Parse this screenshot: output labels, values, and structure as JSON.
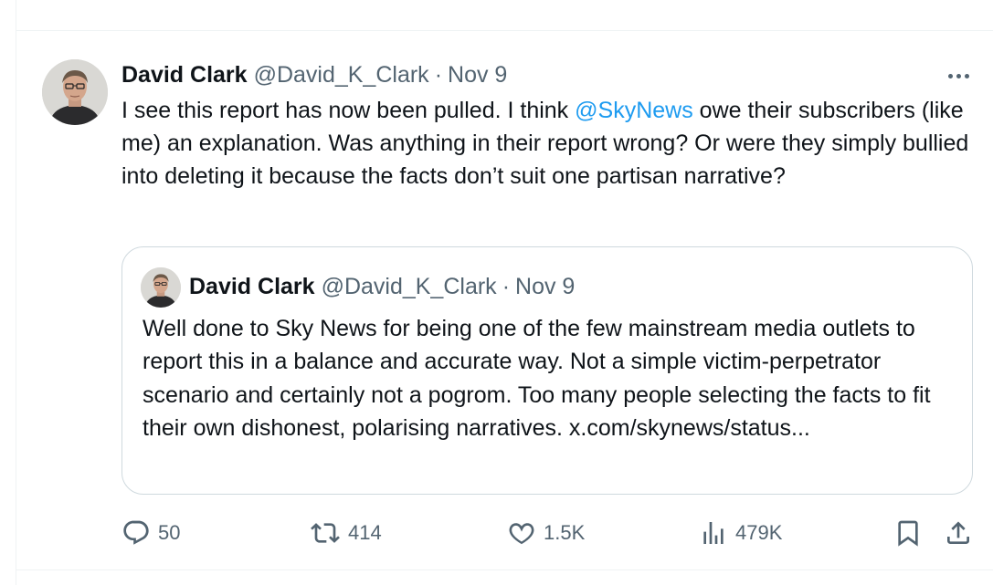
{
  "post": {
    "author_name": "David Clark",
    "author_handle": "@David_K_Clark",
    "separator": "·",
    "date": "Nov 9",
    "text_before_mention": "I see this report has now been pulled. I think ",
    "mention": "@SkyNews",
    "text_after_mention": " owe their subscribers (like me) an explanation. Was anything in their report wrong? Or were they simply bullied into deleting it because the facts don’t suit one partisan narrative?"
  },
  "quote": {
    "author_name": "David Clark",
    "author_handle": "@David_K_Clark",
    "separator": "·",
    "date": "Nov 9",
    "text": "Well done to Sky News for being one of the few mainstream media outlets to report this in a balance and accurate way. Not a simple victim-perpetrator scenario and certainly not a pogrom. Too many people selecting the facts to fit their own dishonest, polarising narratives. x.com/skynews/status..."
  },
  "actions": {
    "replies": "50",
    "reposts": "414",
    "likes": "1.5K",
    "views": "479K"
  },
  "icons": {
    "more": "more-horizontal-icon",
    "reply": "reply-bubble-icon",
    "repost": "repost-icon",
    "like": "heart-icon",
    "views": "analytics-bars-icon",
    "bookmark": "bookmark-icon",
    "share": "share-upload-icon"
  },
  "colors": {
    "text": "#0f1419",
    "secondary": "#536471",
    "link": "#1d9bf0",
    "border": "#cfd9de"
  }
}
